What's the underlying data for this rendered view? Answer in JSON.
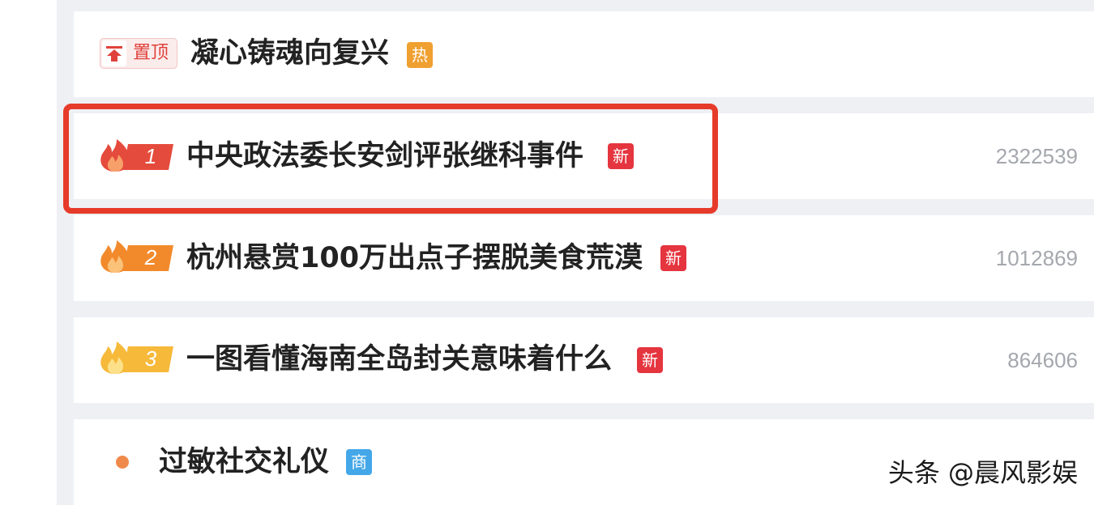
{
  "pinned": {
    "badge_label": "置顶",
    "title": "凝心铸魂向复兴",
    "tag": "热"
  },
  "items": [
    {
      "rank": "1",
      "title": "中央政法委长安剑评张继科事件",
      "tag": "新",
      "count": "2322539",
      "color": "#e54b3c"
    },
    {
      "rank": "2",
      "title": "杭州悬赏100万出点子摆脱美食荒漠",
      "tag": "新",
      "count": "1012869",
      "color": "#f28a2c"
    },
    {
      "rank": "3",
      "title": "一图看懂海南全岛封关意味着什么",
      "tag": "新",
      "count": "864606",
      "color": "#f6b93a"
    }
  ],
  "ad_item": {
    "title": "过敏社交礼仪",
    "tag": "商"
  },
  "watermark": "头条 @晨风影娱",
  "colors": {
    "highlight": "#e63b2a",
    "tag_new": "#e5353f",
    "tag_hot": "#f0a030",
    "tag_biz": "#44a7e8"
  }
}
